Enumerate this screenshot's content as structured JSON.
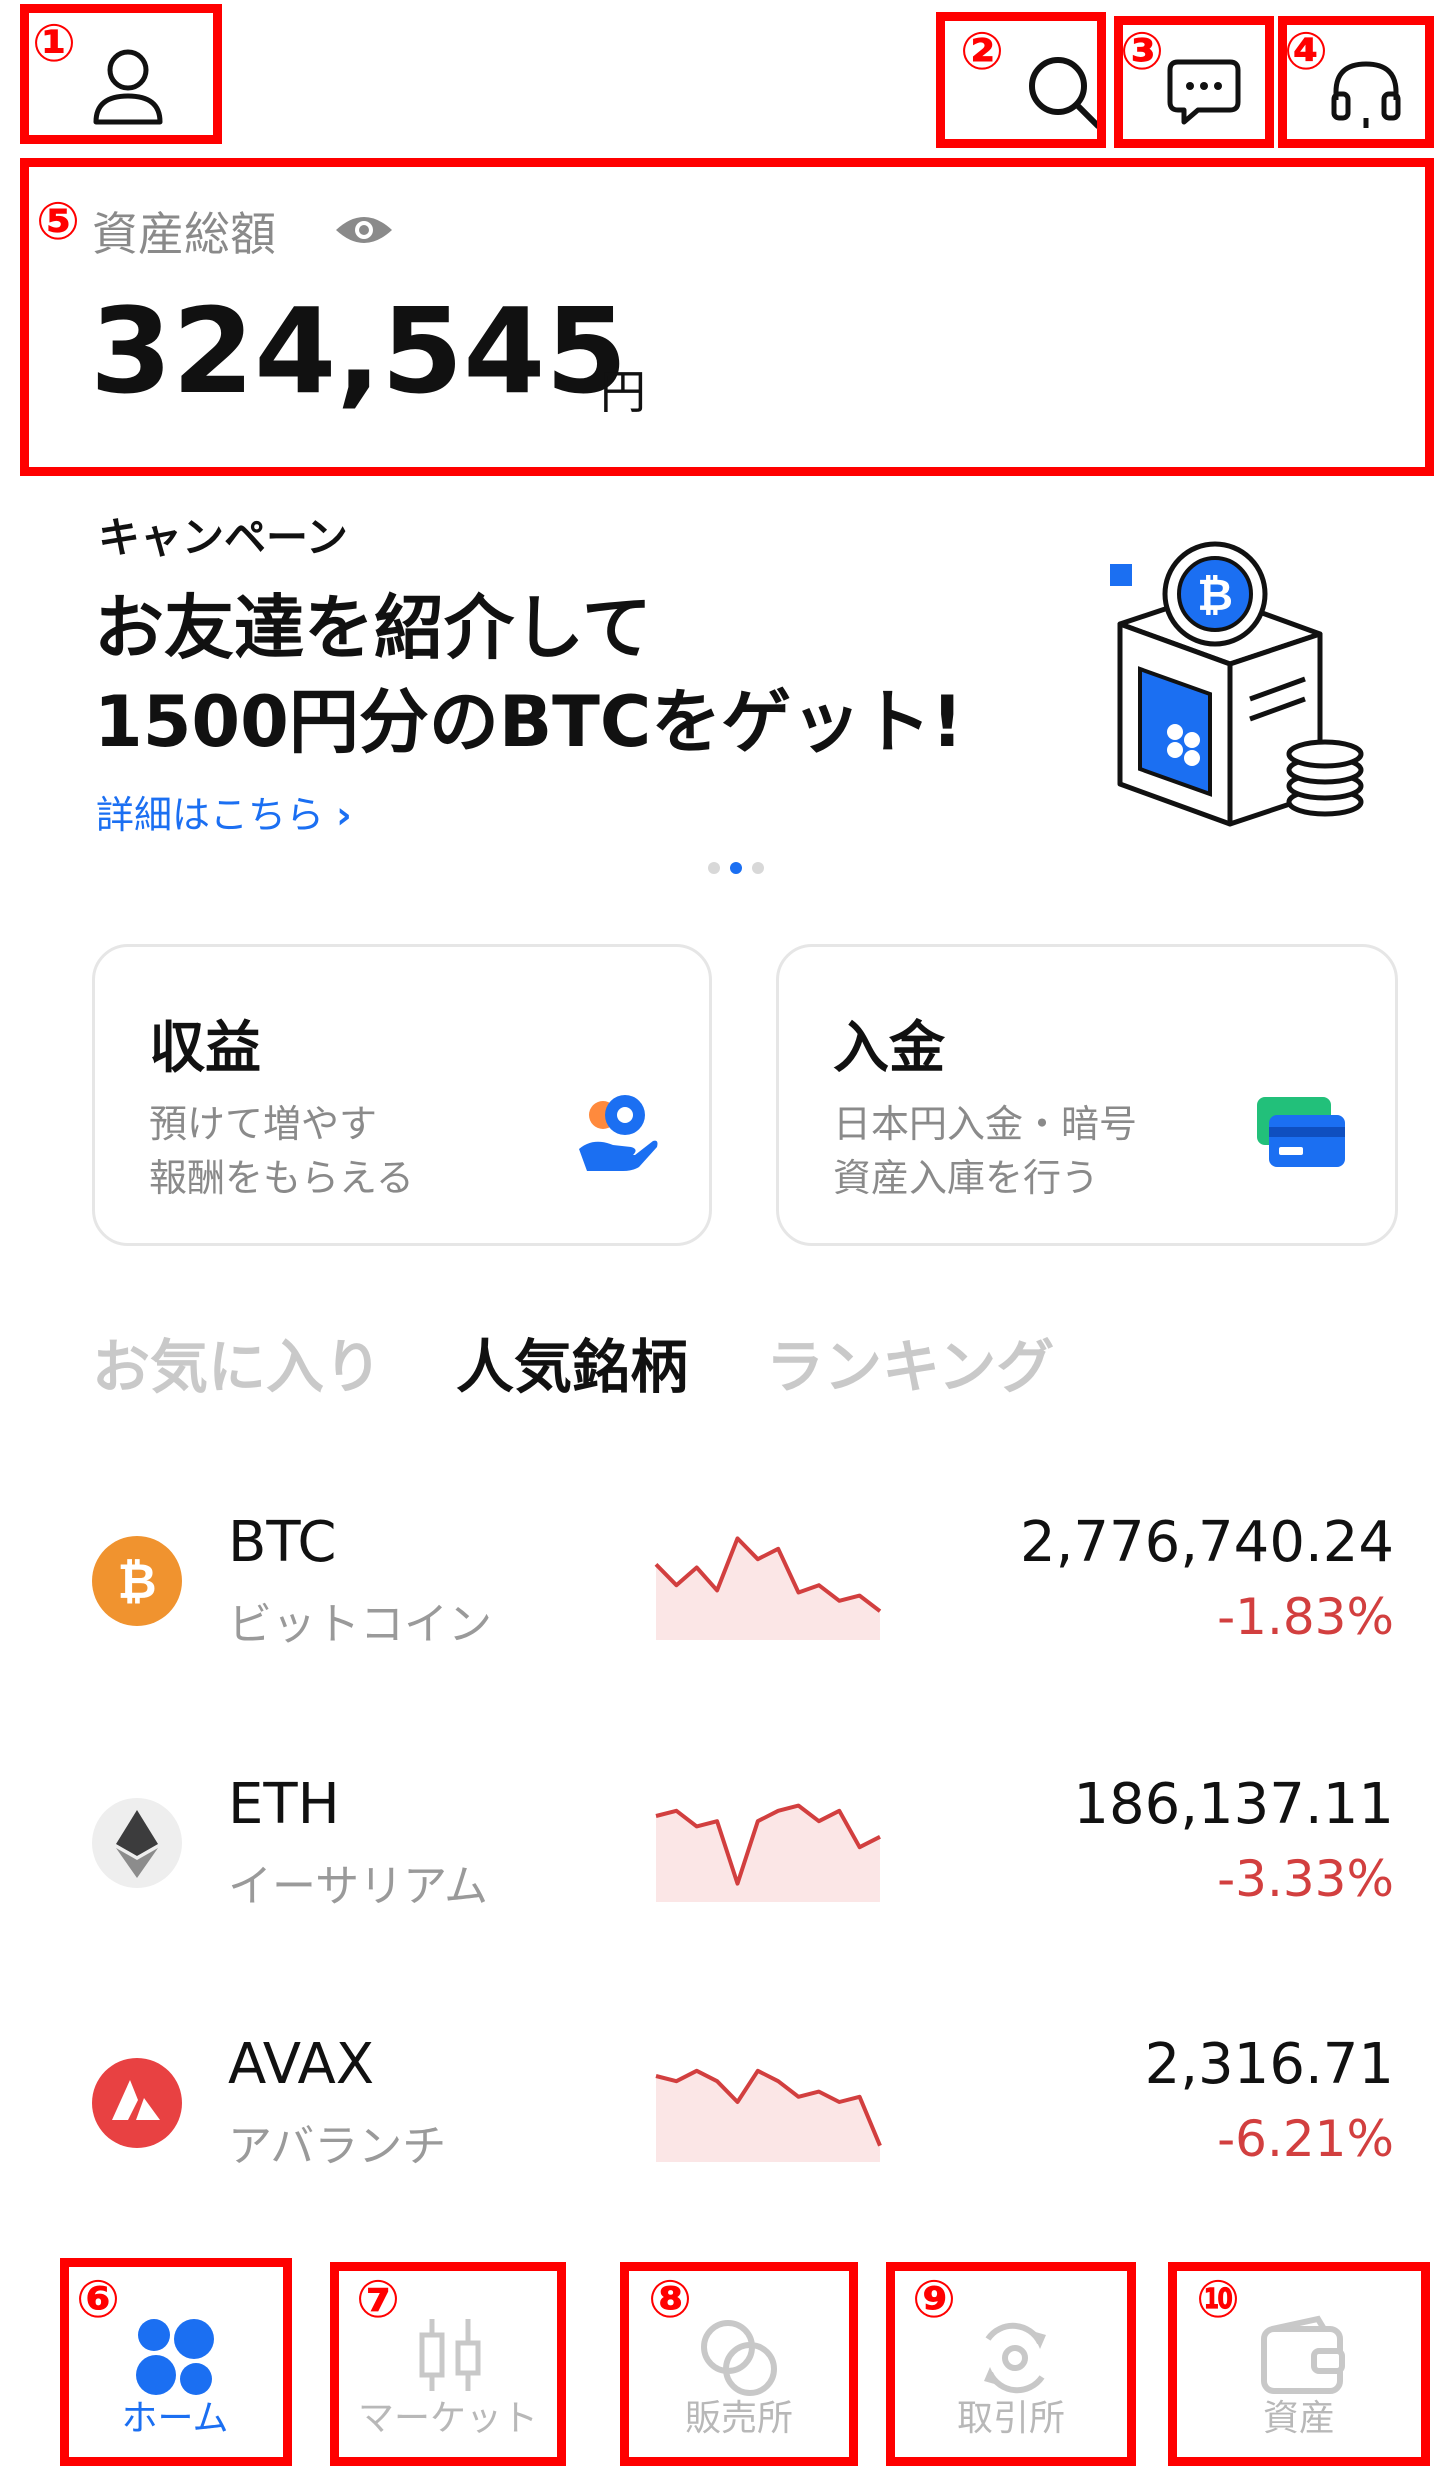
{
  "annotations": [
    "①",
    "②",
    "③",
    "④",
    "⑤",
    "⑥",
    "⑦",
    "⑧",
    "⑨",
    "⑩"
  ],
  "header": {
    "account_icon": "person-icon",
    "search_icon": "search-icon",
    "message_icon": "chat-bubble-icon",
    "support_icon": "headset-icon"
  },
  "assets": {
    "label": "資産総額",
    "visibility_icon": "eye-icon",
    "amount": "324,545",
    "unit": "円"
  },
  "campaign": {
    "tag": "キャンペーン",
    "title_line1": "お友達を紹介して",
    "title_line2": "1500円分のBTCをゲット!",
    "link": "詳細はこちら",
    "link_icon": "chevron-right-icon",
    "pager_active_index": 1,
    "pager_count": 3
  },
  "cards": [
    {
      "title": "収益",
      "sub": "預けて増やす\n報酬をもらえる",
      "icon": "hand-coin-icon"
    },
    {
      "title": "入金",
      "sub": "日本円入金・暗号\n資産入庫を行う",
      "icon": "card-deposit-icon"
    }
  ],
  "tabs": [
    {
      "label": "お気に入り",
      "active": false
    },
    {
      "label": "人気銘柄",
      "active": true
    },
    {
      "label": "ランキング",
      "active": false
    }
  ],
  "coins": [
    {
      "symbol": "BTC",
      "name": "ビットコイン",
      "price": "2,776,740.24",
      "change": "-1.83%",
      "icon": "bitcoin-icon",
      "color": "#f0932f",
      "spark": [
        0.35,
        0.55,
        0.38,
        0.6,
        0.1,
        0.3,
        0.2,
        0.62,
        0.55,
        0.7,
        0.65,
        0.8
      ]
    },
    {
      "symbol": "ETH",
      "name": "イーサリアム",
      "price": "186,137.11",
      "change": "-3.33%",
      "icon": "ethereum-icon",
      "color": "#eeeeee",
      "spark": [
        0.25,
        0.2,
        0.35,
        0.3,
        0.9,
        0.3,
        0.2,
        0.15,
        0.3,
        0.2,
        0.55,
        0.45
      ]
    },
    {
      "symbol": "AVAX",
      "name": "アバランチ",
      "price": "2,316.71",
      "change": "-6.21%",
      "icon": "avalanche-icon",
      "color": "#e84142",
      "spark": [
        0.25,
        0.3,
        0.2,
        0.3,
        0.5,
        0.2,
        0.3,
        0.45,
        0.4,
        0.5,
        0.45,
        0.92
      ]
    }
  ],
  "colors": {
    "accent": "#1b6ff2",
    "down": "#d23f3f",
    "annotation": "#ff0000"
  },
  "nav": [
    {
      "label": "ホーム",
      "icon": "home-dots-icon",
      "active": true
    },
    {
      "label": "マーケット",
      "icon": "candlestick-icon",
      "active": false
    },
    {
      "label": "販売所",
      "icon": "coins-icon",
      "active": false
    },
    {
      "label": "取引所",
      "icon": "exchange-icon",
      "active": false
    },
    {
      "label": "資産",
      "icon": "wallet-icon",
      "active": false
    }
  ]
}
